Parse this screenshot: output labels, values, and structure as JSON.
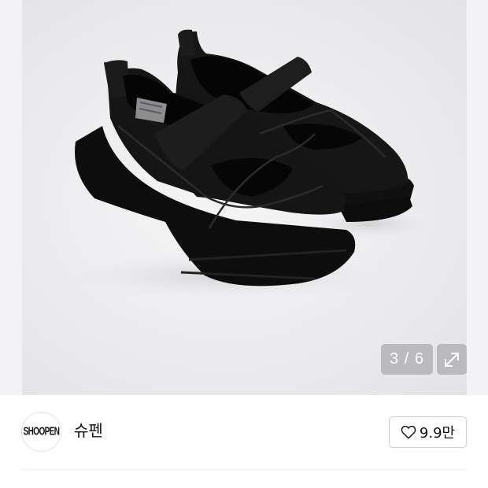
{
  "gallery": {
    "image_alt": "black velcro-strap chunky sneakers",
    "counter": "3 / 6",
    "current_index": 3,
    "total_images": 6,
    "expand_icon": "expand-arrows-icon"
  },
  "seller": {
    "logo_text": "SHOOPEN",
    "name": "슈펜"
  },
  "like": {
    "icon": "heart-outline-icon",
    "count": "9.9만"
  },
  "colors": {
    "gallery_bg": "#ebebee",
    "shoe": "#141414",
    "badge_bg": "#96969a",
    "border": "#cfcfcf"
  }
}
